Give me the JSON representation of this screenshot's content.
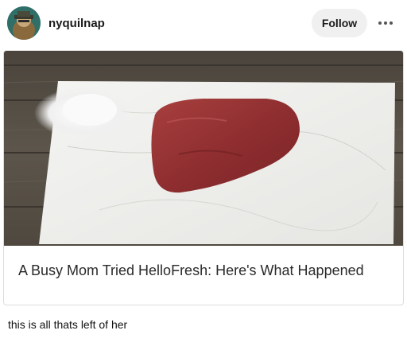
{
  "post": {
    "username": "nyquilnap",
    "follow_label": "Follow",
    "link_card": {
      "title": "A Busy Mom Tried HelloFresh: Here's What Happened"
    },
    "caption": "this is all thats left of her"
  },
  "icons": {
    "avatar": "avatar-icon",
    "more": "more-options-icon"
  },
  "colors": {
    "follow_button_bg": "#f0f0f0",
    "text": "#1a1a1a"
  }
}
